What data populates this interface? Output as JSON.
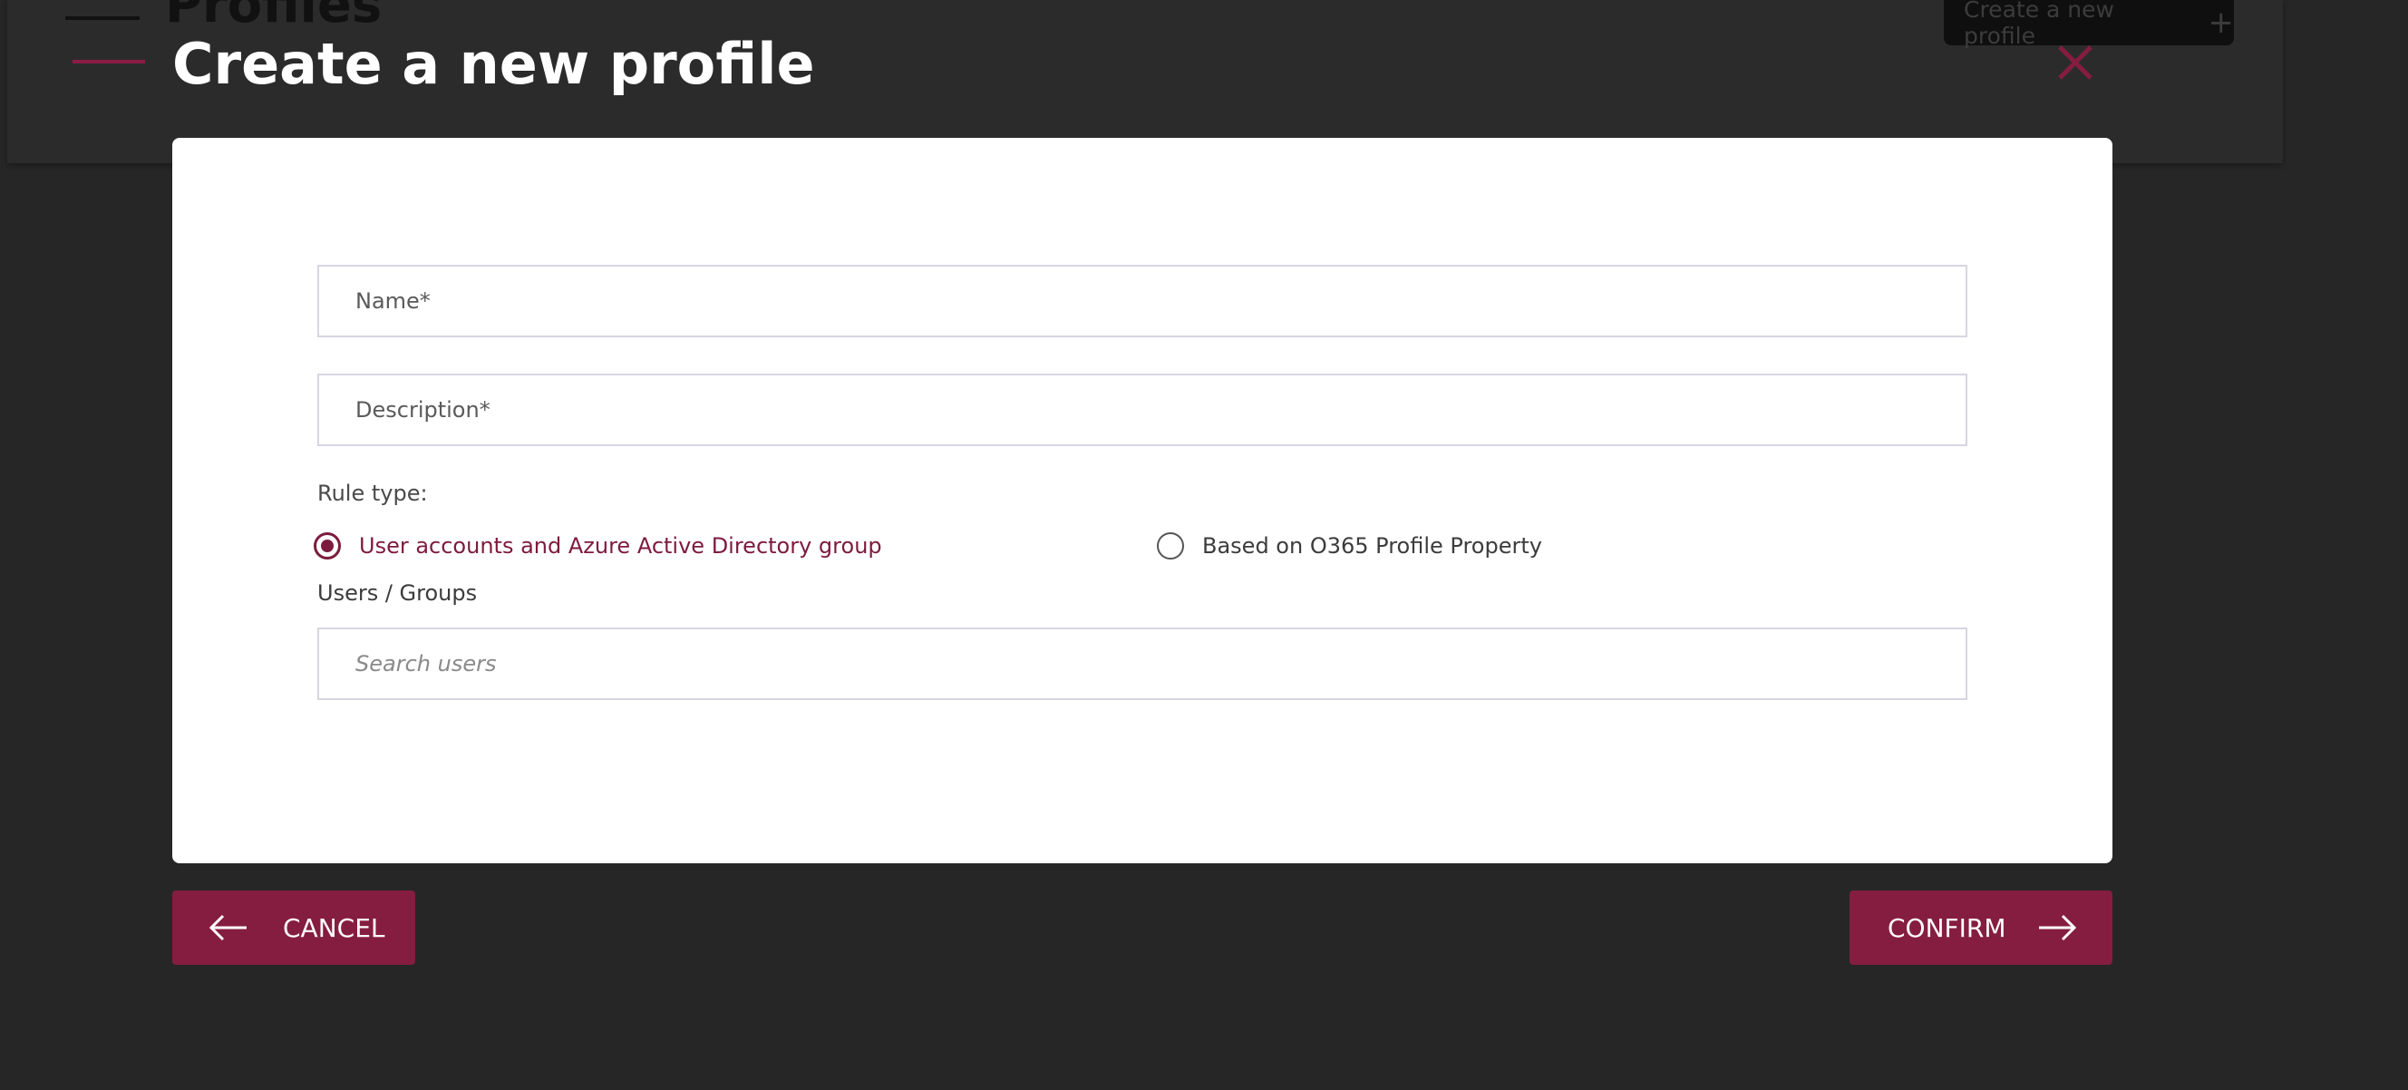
{
  "background": {
    "page_title": "Profiles",
    "create_button_label": "Create a new profile"
  },
  "modal": {
    "title": "Create a new profile",
    "name_placeholder": "Name*",
    "description_placeholder": "Description*",
    "rule_type_label": "Rule type:",
    "rule_options": [
      {
        "label": "User accounts and Azure Active Directory group",
        "selected": true
      },
      {
        "label": "Based on O365 Profile Property",
        "selected": false
      }
    ],
    "users_groups_label": "Users / Groups",
    "search_placeholder": "Search users",
    "cancel_label": "CANCEL",
    "confirm_label": "CONFIRM"
  },
  "colors": {
    "accent": "#851d41",
    "overlay": "#262626",
    "panel": "#ffffff"
  },
  "icons": {
    "close": "close-icon",
    "back": "arrow-left-icon",
    "forward": "arrow-right-icon",
    "plus": "plus-icon"
  }
}
